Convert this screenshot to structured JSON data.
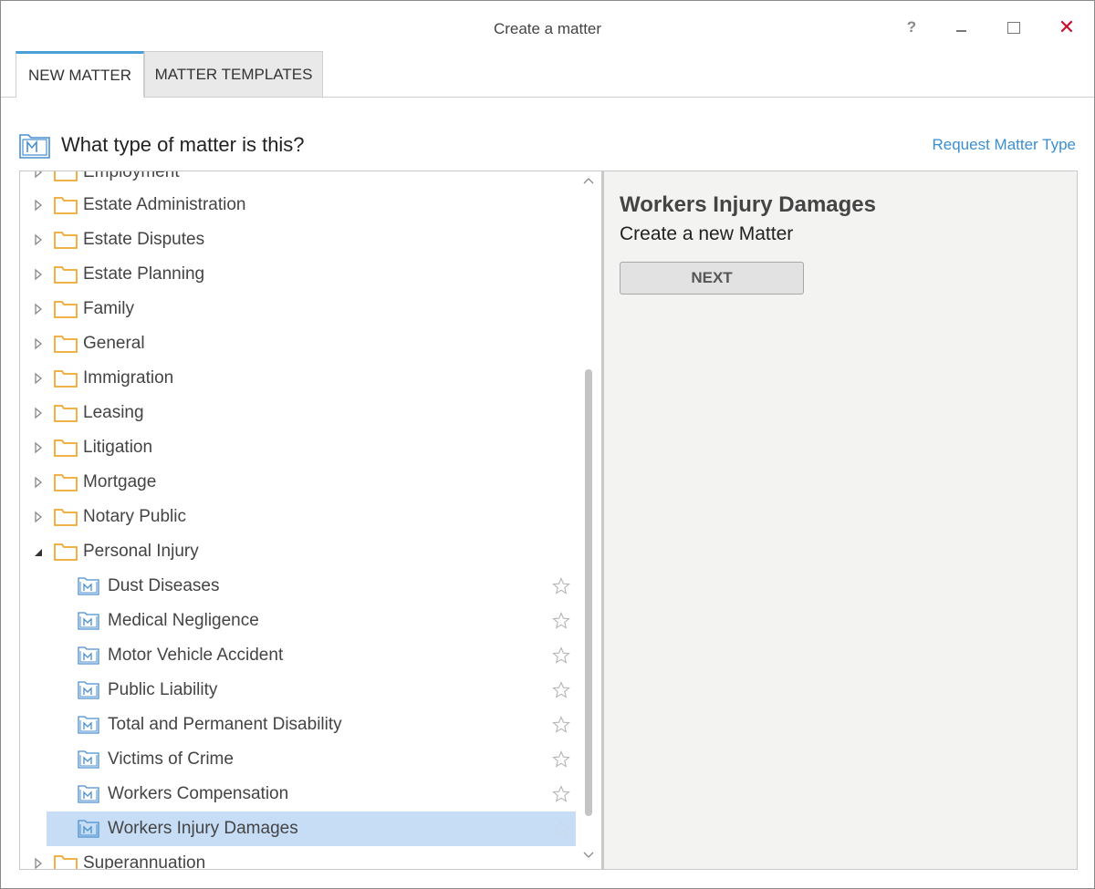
{
  "window": {
    "title": "Create a matter",
    "help_label": "?",
    "close_label": "✕"
  },
  "tabs": [
    {
      "label": "NEW MATTER"
    },
    {
      "label": "MATTER TEMPLATES"
    }
  ],
  "question": "What type of matter is this?",
  "request_link": "Request Matter Type",
  "tree": {
    "folders_top": [
      {
        "label": "Employment"
      },
      {
        "label": "Estate Administration"
      },
      {
        "label": "Estate Disputes"
      },
      {
        "label": "Estate Planning"
      },
      {
        "label": "Family"
      },
      {
        "label": "General"
      },
      {
        "label": "Immigration"
      },
      {
        "label": "Leasing"
      },
      {
        "label": "Litigation"
      },
      {
        "label": "Mortgage"
      },
      {
        "label": "Notary Public"
      }
    ],
    "expanded_folder": {
      "label": "Personal Injury"
    },
    "children": [
      {
        "label": "Dust Diseases"
      },
      {
        "label": "Medical Negligence"
      },
      {
        "label": "Motor Vehicle Accident"
      },
      {
        "label": "Public Liability"
      },
      {
        "label": "Total and Permanent Disability"
      },
      {
        "label": "Victims of Crime"
      },
      {
        "label": "Workers Compensation"
      },
      {
        "label": "Workers Injury Damages"
      }
    ],
    "folders_bottom": [
      {
        "label": "Superannuation"
      }
    ]
  },
  "detail": {
    "title": "Workers Injury Damages",
    "subtitle": "Create a new Matter",
    "next_label": "NEXT"
  },
  "colors": {
    "accent": "#4a9fd5",
    "link": "#3b8fd1",
    "folder": "#f0a830",
    "selection": "#c6ddf5",
    "close": "#c8102e"
  }
}
